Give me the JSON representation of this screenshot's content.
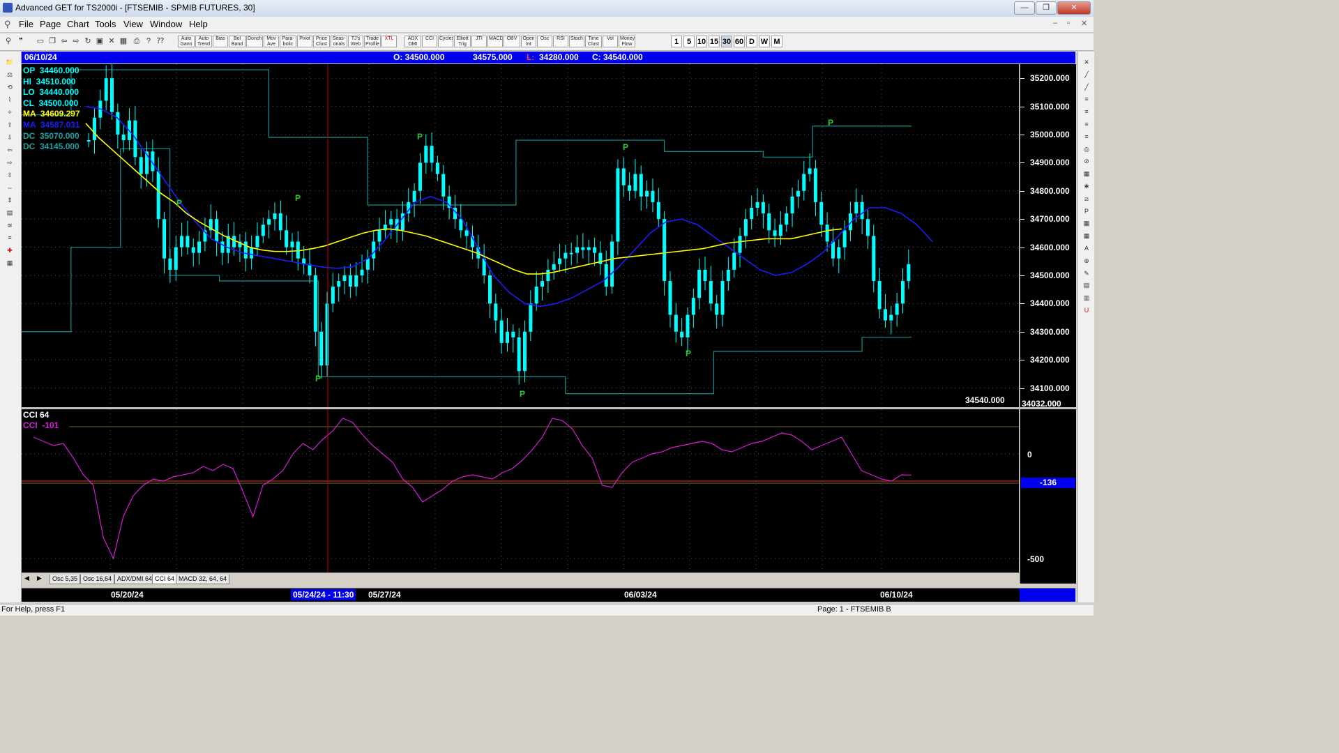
{
  "window": {
    "title": "Advanced GET for TS2000i - [FTSEMIB - SPMIB FUTURES, 30]",
    "buttons": [
      "—",
      "❐",
      "✕"
    ]
  },
  "menu": [
    "File",
    "Page",
    "Chart",
    "Tools",
    "View",
    "Window",
    "Help"
  ],
  "toolbar": {
    "buttons": [
      "Auto Gann",
      "Auto Trend",
      "Bias",
      "Bol Band",
      "Donch",
      "Mov Ave",
      "Para-bolic",
      "Pivot",
      "Price Clust",
      "Seas-onals",
      "TJ's Web",
      "Trade Profile",
      "XTL",
      "ADX DMI",
      "CCI",
      "Cycles",
      "Elliott Trig",
      "JTI",
      "MACD",
      "OBV",
      "Open Int",
      "Osc",
      "RSI",
      "Stoch",
      "Time Clust",
      "Vol",
      "Money Flow"
    ],
    "periods": [
      "1",
      "5",
      "10",
      "15",
      "30",
      "60",
      "D",
      "W",
      "M"
    ],
    "active_period": "30"
  },
  "header_bar": {
    "date": "06/10/24",
    "open": "O: 34500.000",
    "high": "34575.000",
    "low_label": "L:",
    "low": "34280.000",
    "close": "C: 34540.000"
  },
  "readouts": [
    {
      "label": "OP",
      "value": "34460.000",
      "color": "#00ffff"
    },
    {
      "label": "HI",
      "value": "34510.000",
      "color": "#00ffff"
    },
    {
      "label": "LO",
      "value": "34440.000",
      "color": "#00ffff"
    },
    {
      "label": "CL",
      "value": "34500.000",
      "color": "#00ffff"
    },
    {
      "label": "MA",
      "value": "34609.297",
      "color": "#ffff00"
    },
    {
      "label": "MA",
      "value": "34587.031",
      "color": "#1c1cff"
    },
    {
      "label": "DC",
      "value": "35070.000",
      "color": "#1aa0a0"
    },
    {
      "label": "DC",
      "value": "34145.000",
      "color": "#1aa0a0"
    }
  ],
  "price_axis": {
    "ticks": [
      "35200.000",
      "35100.000",
      "35000.000",
      "34900.000",
      "34800.000",
      "34700.000",
      "34600.000",
      "34500.000",
      "34400.000",
      "34300.000",
      "34200.000",
      "34100.000"
    ],
    "last_price": "34540.000",
    "bottom_clipped": "34032.000"
  },
  "indicator": {
    "name": "CCI 64",
    "readout": "CCI  -101",
    "axis": [
      "0",
      "-500"
    ],
    "marker_value": "-136"
  },
  "tabs": [
    "Osc 5,35",
    "Osc 16,64",
    "ADX/DMI 64",
    "CCI 64",
    "MACD 32, 64, 64"
  ],
  "active_tab": "CCI 64",
  "time_axis": {
    "labels": [
      "05/20/24",
      "05/27/24",
      "06/03/24",
      "06/10/24"
    ],
    "cursor_label": "05/24/24 - 11:30"
  },
  "status": {
    "help": "For Help, press F1",
    "page": "Page: 1 - FTSEMIB B"
  },
  "pivot_marker": "P",
  "colors": {
    "candles": "#00ffff",
    "ma_fast": "#ffff00",
    "ma_slow": "#1c1cff",
    "donchian": "#1a8f8f",
    "cci": "#d61ed6",
    "pivot": "#2ecc2e",
    "cursor": "#c00000"
  },
  "chart_data": {
    "type": "candlestick",
    "symbol": "FTSEMIB - SPMIB FUTURES",
    "interval_minutes": 30,
    "ylim": [
      34032,
      35250
    ],
    "close_series": [
      34980,
      35060,
      35120,
      35200,
      35080,
      35000,
      34980,
      35050,
      34920,
      34860,
      34940,
      34870,
      34700,
      34560,
      34520,
      34600,
      34640,
      34600,
      34580,
      34620,
      34660,
      34700,
      34620,
      34580,
      34640,
      34600,
      34620,
      34560,
      34600,
      34640,
      34680,
      34700,
      34720,
      34660,
      34600,
      34620,
      34560,
      34540,
      34500,
      34300,
      34180,
      34400,
      34460,
      34480,
      34500,
      34460,
      34500,
      34520,
      34560,
      34620,
      34660,
      34680,
      34700,
      34660,
      34720,
      34760,
      34800,
      34900,
      34960,
      34900,
      34860,
      34780,
      34740,
      34700,
      34660,
      34640,
      34600,
      34560,
      34500,
      34400,
      34340,
      34260,
      34300,
      34280,
      34160,
      34300,
      34400,
      34460,
      34480,
      34520,
      34540,
      34560,
      34580,
      34580,
      34600,
      34590,
      34600,
      34580,
      34540,
      34460,
      34620,
      34880,
      34820,
      34800,
      34860,
      34780,
      34800,
      34760,
      34700,
      34480,
      34360,
      34300,
      34280,
      34360,
      34420,
      34520,
      34480,
      34400,
      34360,
      34480,
      34520,
      34580,
      34640,
      34700,
      34740,
      34760,
      34720,
      34660,
      34640,
      34680,
      34720,
      34780,
      34800,
      34860,
      34880,
      34760,
      34680,
      34620,
      34560,
      34600,
      34660,
      34720,
      34760,
      34700,
      34640,
      34480,
      34380,
      34340,
      34360,
      34400,
      34480,
      34540
    ],
    "ma_fast_series": [
      35040,
      34990,
      34950,
      34910,
      34870,
      34830,
      34790,
      34760,
      34720,
      34690,
      34665,
      34640,
      34620,
      34600,
      34590,
      34585,
      34585,
      34588,
      34595,
      34605,
      34620,
      34635,
      34650,
      34660,
      34665,
      34660,
      34650,
      34640,
      34625,
      34610,
      34595,
      34580,
      34560,
      34540,
      34520,
      34505,
      34505,
      34510,
      34520,
      34530,
      34540,
      34550,
      34560,
      34565,
      34570,
      34575,
      34580,
      34585,
      34590,
      34595,
      34605,
      34615,
      34620,
      34625,
      34630,
      34630,
      34630,
      34640,
      34650,
      34660,
      34665
    ],
    "ma_slow_series": [
      35100,
      35090,
      35060,
      35000,
      34920,
      34840,
      34760,
      34690,
      34630,
      34600,
      34580,
      34570,
      34560,
      34550,
      34540,
      34530,
      34525,
      34530,
      34560,
      34620,
      34690,
      34760,
      34780,
      34760,
      34700,
      34600,
      34500,
      34440,
      34400,
      34390,
      34400,
      34420,
      34450,
      34480,
      34530,
      34590,
      34650,
      34690,
      34700,
      34680,
      34640,
      34600,
      34560,
      34520,
      34500,
      34510,
      34540,
      34580,
      34640,
      34700,
      34740,
      34740,
      34720,
      34680,
      34620
    ],
    "donchian_upper": [
      35070,
      35230,
      35230,
      35230,
      35230,
      34990,
      34990,
      34750,
      34750,
      34750,
      34980,
      34980,
      34980,
      34940,
      34940,
      34920,
      35030,
      35030
    ],
    "donchian_lower": [
      34300,
      34600,
      34950,
      34500,
      34480,
      34480,
      34140,
      34140,
      34140,
      34140,
      34140,
      34080,
      34080,
      34080,
      34230,
      34230,
      34230,
      34280
    ],
    "pivot_labels": [
      "P",
      "P",
      "P",
      "P",
      "P",
      "P",
      "P",
      "P",
      "P"
    ],
    "cci_series": [
      80,
      60,
      40,
      50,
      -20,
      -100,
      -150,
      -400,
      -500,
      -300,
      -200,
      -150,
      -120,
      -130,
      -110,
      -100,
      -90,
      -60,
      -80,
      -50,
      -70,
      -180,
      -300,
      -150,
      -120,
      -80,
      0,
      50,
      20,
      70,
      110,
      170,
      150,
      90,
      40,
      0,
      -40,
      -120,
      -160,
      -230,
      -200,
      -170,
      -130,
      -110,
      -100,
      -110,
      -120,
      -90,
      -70,
      -30,
      20,
      80,
      170,
      160,
      120,
      40,
      -20,
      -150,
      -160,
      -90,
      -40,
      -20,
      0,
      10,
      30,
      40,
      50,
      60,
      50,
      20,
      10,
      30,
      50,
      60,
      80,
      100,
      90,
      60,
      20,
      40,
      60,
      80,
      0,
      -80,
      -100,
      -120,
      -130,
      -100,
      -101
    ]
  }
}
